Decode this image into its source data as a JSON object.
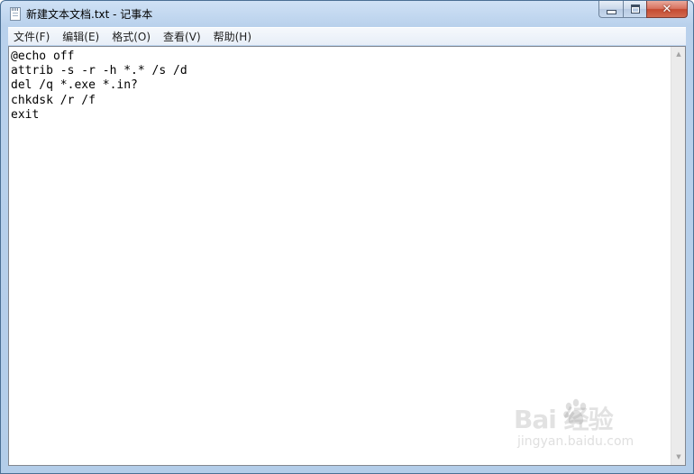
{
  "window": {
    "title": "新建文本文档.txt - 记事本",
    "close_glyph": "✕"
  },
  "menu": {
    "items": [
      {
        "label": "文件(F)"
      },
      {
        "label": "编辑(E)"
      },
      {
        "label": "格式(O)"
      },
      {
        "label": "查看(V)"
      },
      {
        "label": "帮助(H)"
      }
    ]
  },
  "editor": {
    "content": "@echo off\nattrib -s -r -h *.* /s /d\ndel /q *.exe *.in?\nchkdsk /r /f\nexit"
  },
  "scrollbar": {
    "up_glyph": "▲",
    "down_glyph": "▼"
  },
  "watermark": {
    "brand": "Bai  经验",
    "url": "jingyan.baidu.com"
  },
  "icons": {
    "app": "notepad-icon",
    "minimize": "minimize-icon",
    "maximize": "maximize-icon",
    "close": "close-icon",
    "paw": "paw-icon"
  }
}
